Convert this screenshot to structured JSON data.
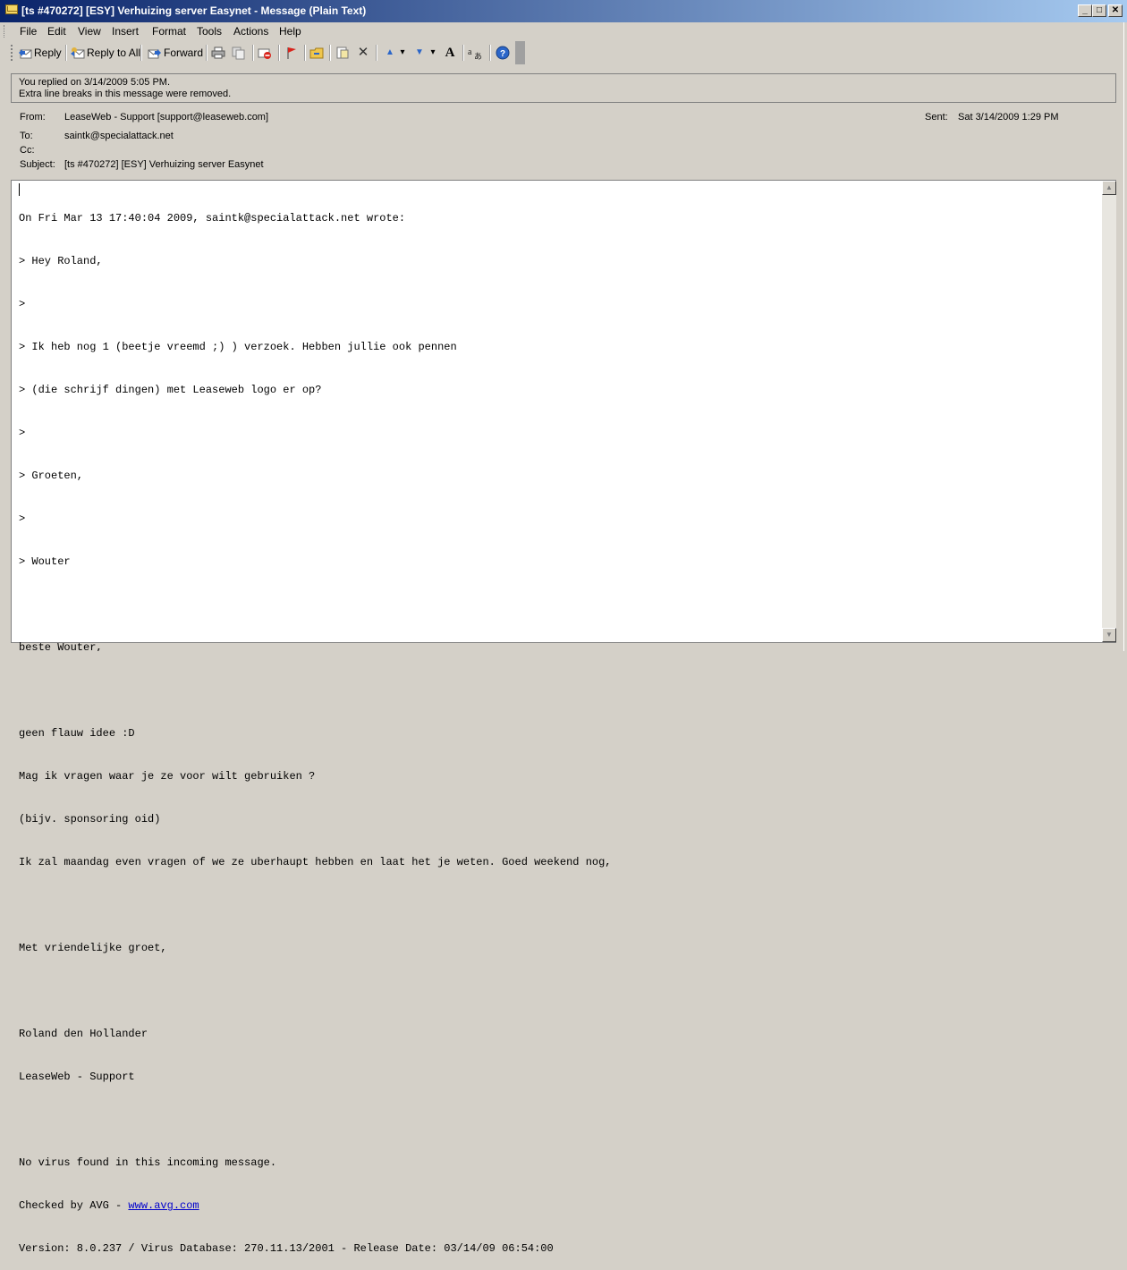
{
  "window": {
    "title": "[ts #470272] [ESY] Verhuizing server Easynet  - Message (Plain Text)",
    "minimize_glyph": "_",
    "maximize_glyph": "□",
    "close_glyph": "✕"
  },
  "menu": {
    "items": [
      {
        "label": "File"
      },
      {
        "label": "Edit"
      },
      {
        "label": "View"
      },
      {
        "label": "Insert"
      },
      {
        "label": "Format"
      },
      {
        "label": "Tools"
      },
      {
        "label": "Actions"
      },
      {
        "label": "Help"
      }
    ]
  },
  "toolbar": {
    "reply_label": "Reply",
    "reply_all_label": "Reply to All",
    "forward_label": "Forward",
    "icons": {
      "reply": "reply-icon",
      "reply_all": "reply-all-icon",
      "forward": "forward-icon",
      "print": "print-icon",
      "copy": "copy-icon",
      "flag_message": "delete-red-icon",
      "follow_up": "flag-icon",
      "move": "move-to-folder-icon",
      "categories": "categories-icon",
      "delete": "delete-icon",
      "previous": "previous-item-icon",
      "next": "next-item-icon",
      "font": "font-size-icon",
      "encoding": "encoding-icon",
      "help": "help-icon"
    },
    "glyphs": {
      "delete": "✕",
      "previous": "▲",
      "next": "▼",
      "dropdown": "▾",
      "font": "A",
      "help": "?"
    }
  },
  "infobar": {
    "line1": "You replied on 3/14/2009 5:05 PM.",
    "line2": "Extra line breaks in this message were removed."
  },
  "header": {
    "from_label": "From:",
    "from_value": "LeaseWeb - Support  [support@leaseweb.com]",
    "sent_label": "Sent:",
    "sent_value": "Sat 3/14/2009 1:29 PM",
    "to_label": "To:",
    "to_value": "saintk@specialattack.net",
    "cc_label": "Cc:",
    "cc_value": "",
    "subject_label": "Subject:",
    "subject_value": "[ts #470272] [ESY] Verhuizing server Easynet"
  },
  "message": {
    "lines": [
      "On Fri Mar 13 17:40:04 2009, saintk@specialattack.net wrote:",
      "> Hey Roland,",
      ">",
      "> Ik heb nog 1 (beetje vreemd ;) ) verzoek. Hebben jullie ook pennen",
      "> (die schrijf dingen) met Leaseweb logo er op?",
      ">",
      "> Groeten,",
      ">",
      "> Wouter",
      "",
      "beste Wouter,",
      "",
      "geen flauw idee :D",
      "Mag ik vragen waar je ze voor wilt gebruiken ?",
      "(bijv. sponsoring oid)",
      "Ik zal maandag even vragen of we ze uberhaupt hebben en laat het je weten. Goed weekend nog,",
      "",
      "Met vriendelijke groet,",
      "",
      "Roland den Hollander",
      "LeaseWeb - Support",
      "",
      "No virus found in this incoming message."
    ],
    "avg_prefix": "Checked by AVG - ",
    "avg_link": "www.avg.com",
    "version_line": "Version: 8.0.237 / Virus Database: 270.11.13/2001 - Release Date: 03/14/09 06:54:00"
  },
  "scrollbar": {
    "up_glyph": "▲",
    "down_glyph": "▼"
  }
}
